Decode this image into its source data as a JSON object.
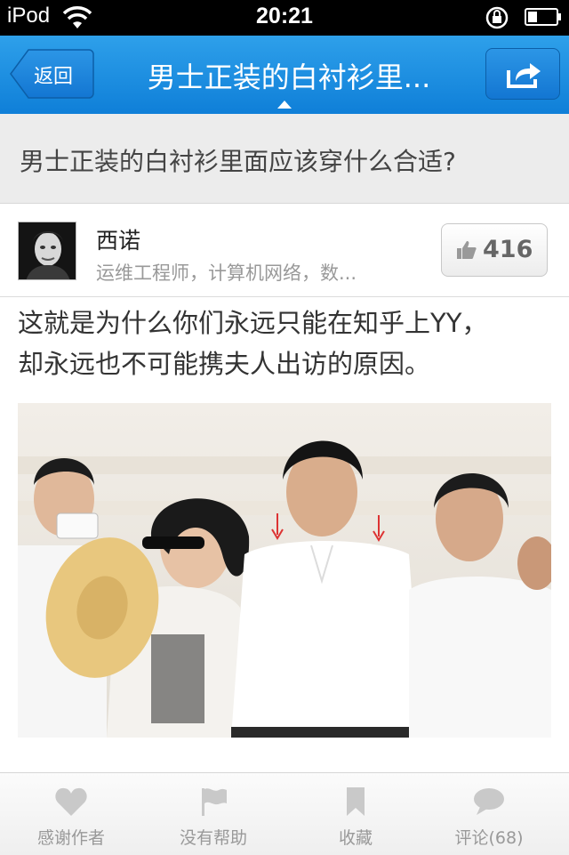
{
  "status_bar": {
    "carrier": "iPod",
    "time": "20:21",
    "wifi_icon": "wifi-icon",
    "lock_icon": "rotation-lock-icon",
    "battery_icon": "battery-icon"
  },
  "nav": {
    "back_label": "返回",
    "title": "男士正装的白衬衫里...",
    "share_icon": "share-icon"
  },
  "question": {
    "title": "男士正装的白衬衫里面应该穿什么合适?"
  },
  "author": {
    "name": "西诺",
    "bio": "运维工程师，计算机网络，数...",
    "vote_count": "416",
    "vote_icon": "thumbs-up-icon"
  },
  "answer": {
    "line1": "这就是为什么你们永远只能在知乎上YY，",
    "line2": "却永远也不可能携夫人出访的原因。"
  },
  "tabbar": {
    "items": [
      {
        "label": "感谢作者",
        "icon": "heart-icon"
      },
      {
        "label": "没有帮助",
        "icon": "flag-icon"
      },
      {
        "label": "收藏",
        "icon": "bookmark-icon"
      },
      {
        "label": "评论(68)",
        "icon": "comment-icon"
      }
    ]
  },
  "colors": {
    "nav_blue": "#1a8ae0",
    "status_bar": "#000000",
    "question_bg": "#ececec"
  }
}
